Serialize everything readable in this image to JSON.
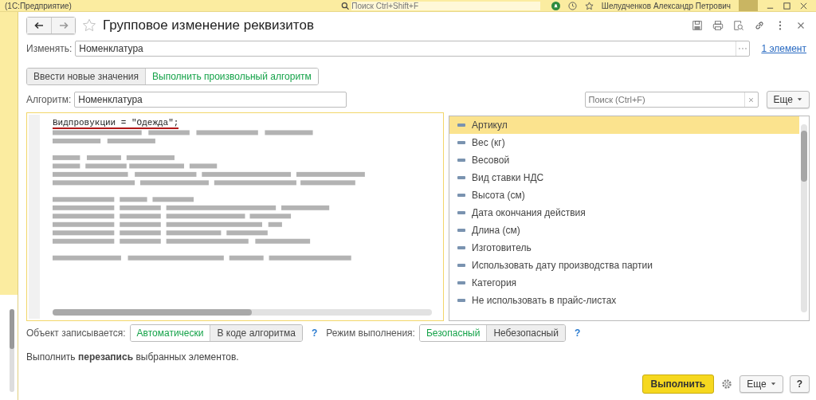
{
  "app_bar": {
    "title": "(1С:Предприятие)",
    "search": {
      "placeholder": "Поиск Ctrl+Shift+F"
    },
    "user": "Шелудченков Александр Петрович"
  },
  "form": {
    "title": "Групповое изменение реквизитов",
    "change_label": "Изменять:",
    "change_value": "Номенклатура",
    "selection_link": "1 элемент",
    "modes": [
      {
        "label": "Ввести новые значения",
        "selected": false
      },
      {
        "label": "Выполнить произвольный алгоритм",
        "selected": true
      }
    ],
    "algorithm_label": "Алгоритм:",
    "algorithm_value": "Номенклатура",
    "code": {
      "first_line": "Видпровукции = \"Одежда\";"
    },
    "attributes": {
      "search": {
        "placeholder": "Поиск (Ctrl+F)"
      },
      "more": "Еще",
      "items": [
        {
          "label": "Артикул",
          "selected": true
        },
        {
          "label": "Вес (кг)",
          "selected": false
        },
        {
          "label": "Весовой",
          "selected": false
        },
        {
          "label": "Вид ставки НДС",
          "selected": false
        },
        {
          "label": "Высота (см)",
          "selected": false
        },
        {
          "label": "Дата окончания действия",
          "selected": false
        },
        {
          "label": "Длина (см)",
          "selected": false
        },
        {
          "label": "Изготовитель",
          "selected": false
        },
        {
          "label": "Использовать дату производства партии",
          "selected": false
        },
        {
          "label": "Категория",
          "selected": false
        },
        {
          "label": "Не использовать в прайс-листах",
          "selected": false
        }
      ]
    },
    "write_mode": {
      "label": "Объект записывается:",
      "options": [
        {
          "label": "Автоматически",
          "selected": true
        },
        {
          "label": "В коде алгоритма",
          "selected": false
        }
      ],
      "help": "?"
    },
    "exec_mode": {
      "label": "Режим выполнения:",
      "options": [
        {
          "label": "Безопасный",
          "selected": true
        },
        {
          "label": "Небезопасный",
          "selected": false
        }
      ],
      "help": "?"
    },
    "note": "Выполнить **перезапись** выбранных элементов.",
    "run": "Выполнить",
    "more": "Еще",
    "help": "?"
  }
}
